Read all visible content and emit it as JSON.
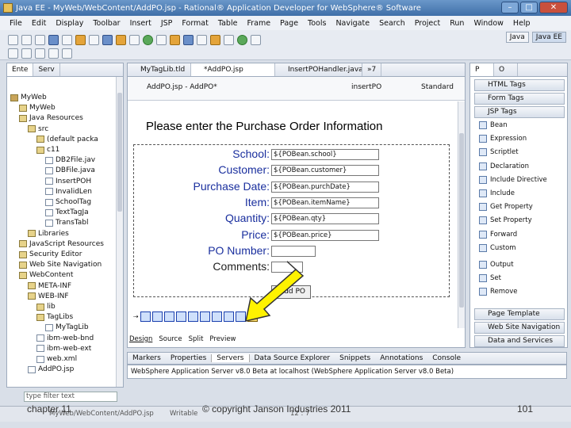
{
  "window": {
    "title": "Java EE - MyWeb/WebContent/AddPO.jsp - Rational® Application Developer for WebSphere® Software"
  },
  "menu": [
    "File",
    "Edit",
    "Display",
    "Toolbar",
    "Insert",
    "JSP",
    "Format",
    "Table",
    "Frame",
    "Page",
    "Tools",
    "Navigate",
    "Search",
    "Project",
    "Run",
    "Window",
    "Help"
  ],
  "perspectives": [
    "Java",
    "Java EE"
  ],
  "left_tabs": [
    "Ente",
    "Serv"
  ],
  "tree": [
    {
      "label": "MyWeb",
      "indent": 0,
      "icon": "project-icon"
    },
    {
      "label": "MyWeb",
      "indent": 1,
      "icon": "folder-icon"
    },
    {
      "label": "Java Resources",
      "indent": 1,
      "icon": "folder-icon"
    },
    {
      "label": "src",
      "indent": 2,
      "icon": "folder-icon"
    },
    {
      "label": "(default packa",
      "indent": 3,
      "icon": "package-icon"
    },
    {
      "label": "c11",
      "indent": 3,
      "icon": "package-icon"
    },
    {
      "label": "DB2File.jav",
      "indent": 4,
      "icon": "file-icon"
    },
    {
      "label": "DBFile.java",
      "indent": 4,
      "icon": "file-icon"
    },
    {
      "label": "InsertPOH",
      "indent": 4,
      "icon": "file-icon"
    },
    {
      "label": "InvalidLen",
      "indent": 4,
      "icon": "file-icon"
    },
    {
      "label": "SchoolTag",
      "indent": 4,
      "icon": "file-icon"
    },
    {
      "label": "TextTagJa",
      "indent": 4,
      "icon": "file-icon"
    },
    {
      "label": "TransTabl",
      "indent": 4,
      "icon": "file-icon"
    },
    {
      "label": "Libraries",
      "indent": 2,
      "icon": "folder-icon"
    },
    {
      "label": "JavaScript Resources",
      "indent": 1,
      "icon": "folder-icon"
    },
    {
      "label": "Security Editor",
      "indent": 1,
      "icon": "folder-icon"
    },
    {
      "label": "Web Site Navigation",
      "indent": 1,
      "icon": "folder-icon"
    },
    {
      "label": "WebContent",
      "indent": 1,
      "icon": "folder-icon"
    },
    {
      "label": "META-INF",
      "indent": 2,
      "icon": "folder-icon"
    },
    {
      "label": "WEB-INF",
      "indent": 2,
      "icon": "folder-icon"
    },
    {
      "label": "lib",
      "indent": 3,
      "icon": "folder-icon"
    },
    {
      "label": "TagLibs",
      "indent": 3,
      "icon": "folder-icon"
    },
    {
      "label": "MyTagLib",
      "indent": 4,
      "icon": "file-icon"
    },
    {
      "label": "ibm-web-bnd",
      "indent": 3,
      "icon": "file-icon"
    },
    {
      "label": "ibm-web-ext",
      "indent": 3,
      "icon": "file-icon"
    },
    {
      "label": "web.xml",
      "indent": 3,
      "icon": "file-icon"
    },
    {
      "label": "AddPO.jsp",
      "indent": 2,
      "icon": "file-icon"
    }
  ],
  "filter": {
    "placeholder": "type filter text"
  },
  "editor_tabs": [
    "MyTagLib.tld",
    "*AddPO.jsp",
    "InsertPOHandler.java",
    "»7"
  ],
  "editor_header": {
    "path": "AddPO.jsp - AddPO*",
    "form_name": "insertPO",
    "style": "Standard"
  },
  "page": {
    "heading": "Please enter the Purchase Order Information",
    "fields": [
      {
        "label": "School:",
        "value": "${POBean.school}"
      },
      {
        "label": "Customer:",
        "value": "${POBean.customer}"
      },
      {
        "label": "Purchase Date:",
        "value": "${POBean.purchDate}"
      },
      {
        "label": "Item:",
        "value": "${POBean.itemName}"
      },
      {
        "label": "Quantity:",
        "value": "${POBean.qty}"
      },
      {
        "label": "Price:",
        "value": "${POBean.price}"
      },
      {
        "label": "PO Number:",
        "value": ""
      },
      {
        "label": "Comments:",
        "value": ""
      }
    ],
    "submit": "Add PO"
  },
  "design_tabs": [
    "Design",
    "Source",
    "Split",
    "Preview"
  ],
  "palette": {
    "groups_top": [
      "HTML Tags",
      "Form Tags",
      "JSP Tags"
    ],
    "jsp_items": [
      "Bean",
      "Expression",
      "Scriptlet",
      "Declaration",
      "Include Directive",
      "Include",
      "Get Property",
      "Set Property",
      "Forward",
      "Custom",
      "Output",
      "Set",
      "Remove"
    ],
    "groups_bottom": [
      "Page Template",
      "Web Site Navigation",
      "Data and Services"
    ]
  },
  "bottom_tabs": [
    "Markers",
    "Properties",
    "Servers",
    "Data Source Explorer",
    "Snippets",
    "Annotations",
    "Console"
  ],
  "server_line": "WebSphere Application Server v8.0 Beta at localhost (WebSphere Application Server v8.0 Beta)",
  "status": {
    "path": "MyWeb/WebContent/AddPO.jsp",
    "mode": "Writable",
    "position": "12 : 7"
  },
  "footer": {
    "left": "chapter 11",
    "center": "© copyright Janson Industries 2011",
    "page": "101"
  }
}
